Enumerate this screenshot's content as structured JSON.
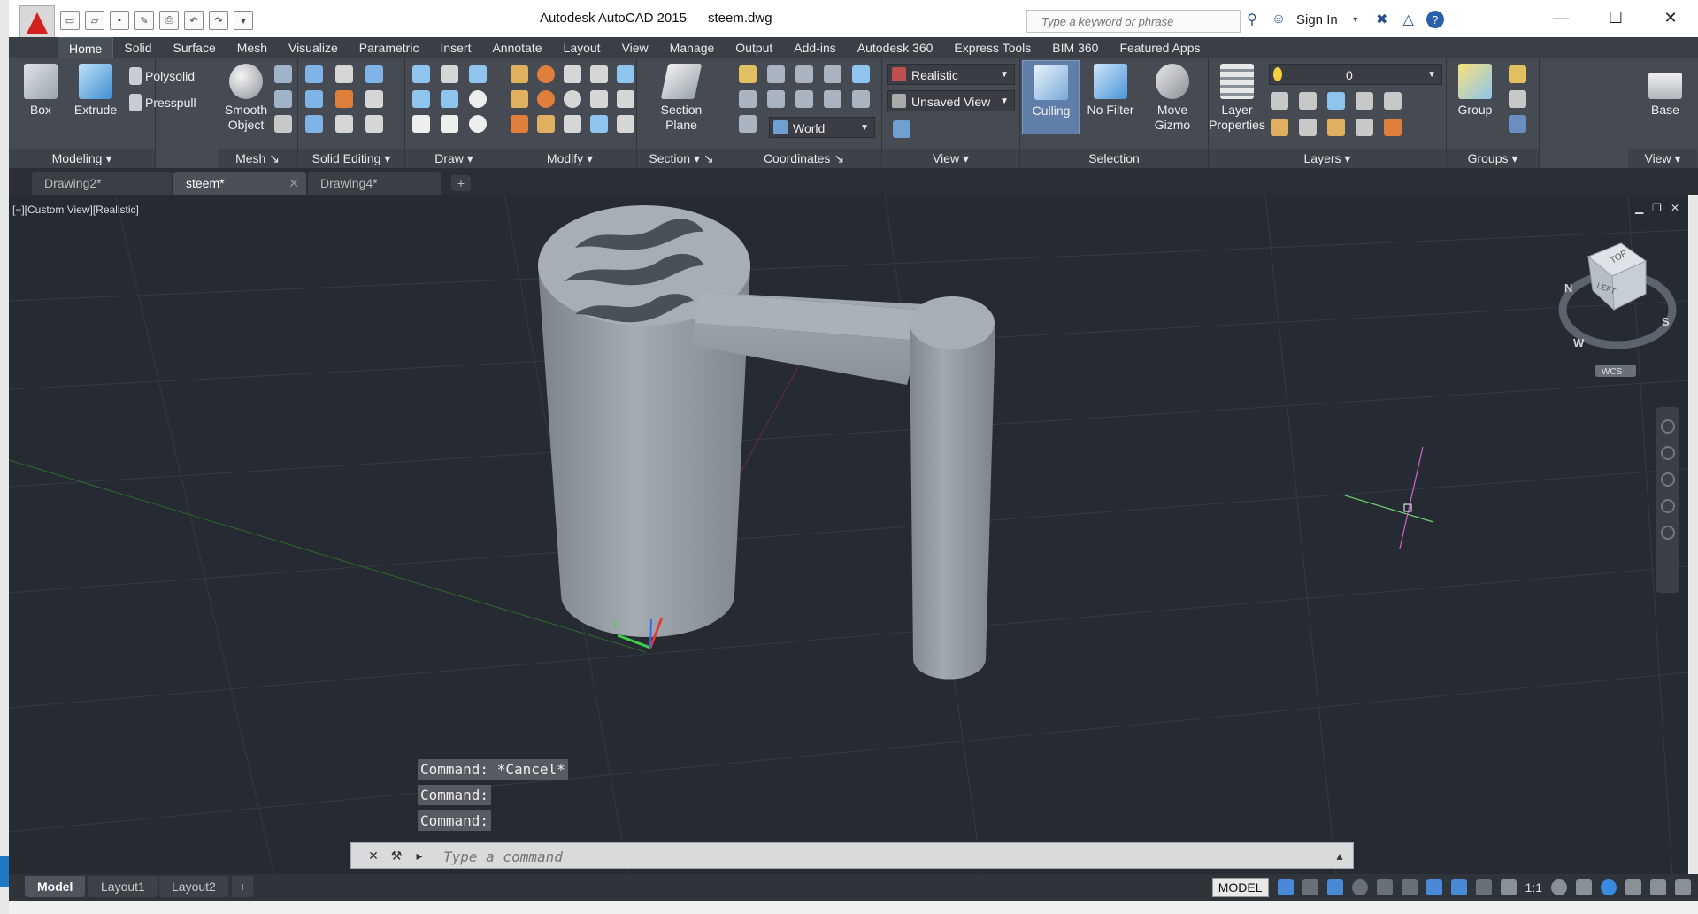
{
  "window": {
    "app_title": "Autodesk AutoCAD 2015",
    "file_name": "steem.dwg",
    "search_placeholder": "Type a keyword or phrase",
    "sign_in": "Sign In",
    "minimize": "—",
    "maximize": "☐",
    "close": "✕"
  },
  "ribbon_tabs": [
    "Home",
    "Solid",
    "Surface",
    "Mesh",
    "Visualize",
    "Parametric",
    "Insert",
    "Annotate",
    "Layout",
    "View",
    "Manage",
    "Output",
    "Add-ins",
    "Autodesk 360",
    "Express Tools",
    "BIM 360",
    "Featured Apps"
  ],
  "panels": {
    "modeling": {
      "label": "Modeling",
      "box": "Box",
      "extrude": "Extrude",
      "polysolid": "Polysolid",
      "presspull": "Presspull"
    },
    "mesh": {
      "label": "Mesh",
      "smooth_object_1": "Smooth",
      "smooth_object_2": "Object"
    },
    "solid_editing": {
      "label": "Solid Editing"
    },
    "draw": {
      "label": "Draw"
    },
    "modify": {
      "label": "Modify"
    },
    "section": {
      "label": "Section",
      "plane_1": "Section",
      "plane_2": "Plane"
    },
    "coordinates": {
      "label": "Coordinates",
      "world": "World"
    },
    "view": {
      "label": "View",
      "visual_style": "Realistic",
      "named_view": "Unsaved View"
    },
    "selection": {
      "label": "Selection",
      "culling": "Culling",
      "no_filter": "No Filter",
      "move_gizmo_1": "Move",
      "move_gizmo_2": "Gizmo"
    },
    "layers": {
      "label": "Layers",
      "layer_properties_1": "Layer",
      "layer_properties_2": "Properties",
      "current_layer": "0"
    },
    "groups": {
      "label": "Groups",
      "group": "Group"
    },
    "view2": {
      "label": "View",
      "base": "Base"
    }
  },
  "doc_tabs": [
    {
      "label": "Drawing2*"
    },
    {
      "label": "steem*"
    },
    {
      "label": "Drawing4*"
    }
  ],
  "viewport": {
    "label": "[−][Custom View][Realistic]",
    "viewcube_top": "TOP",
    "viewcube_left": "LEFT",
    "compass_n": "N",
    "compass_s": "S",
    "compass_w": "W",
    "wcs": "WCS",
    "ucs_y": "Y"
  },
  "command_history": [
    "Command: *Cancel*",
    "Command:",
    "Command:"
  ],
  "command_placeholder": "Type a command",
  "layout_tabs": [
    "Model",
    "Layout1",
    "Layout2"
  ],
  "status": {
    "model": "MODEL",
    "scale": "1:1"
  },
  "colors": {
    "ribbon_bg": "#464b53",
    "viewport_bg": "#262b33",
    "accent": "#d42020",
    "solid_gray": "#8e959c"
  }
}
